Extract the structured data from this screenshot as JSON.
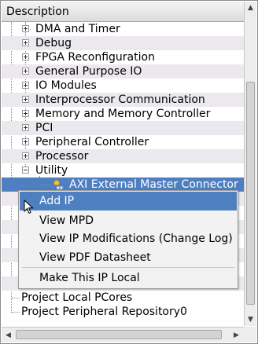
{
  "header": {
    "title": "Description"
  },
  "tree": {
    "items": [
      "DMA and Timer",
      "Debug",
      "FPGA Reconfiguration",
      "General Purpose IO",
      "IO Modules",
      "Interprocessor Communication",
      "Memory and Memory Controller",
      "PCI",
      "Peripheral Controller",
      "Processor",
      "Utility"
    ],
    "selected_child": "AXI External Master Connector",
    "root_items": [
      "Project Local PCores",
      "Project Peripheral Repository0"
    ]
  },
  "context_menu": {
    "items": [
      "Add IP",
      "View MPD",
      "View IP Modifications (Change Log)",
      "View PDF Datasheet",
      "Make This IP Local"
    ],
    "active_item": "Add IP"
  },
  "icons": {
    "expander_collapsed": "plus-box-icon",
    "expander_expanded": "minus-box-icon",
    "ip": "ip-core-icon",
    "scroll_up": "arrow-up-icon",
    "scroll_down": "arrow-down-icon",
    "scroll_left": "arrow-left-icon",
    "scroll_right": "arrow-right-icon",
    "cursor": "mouse-pointer-icon"
  },
  "colors": {
    "selection": "#4d7fc1",
    "alt_row": "#ece9ee",
    "header": "#dcdcdc"
  }
}
